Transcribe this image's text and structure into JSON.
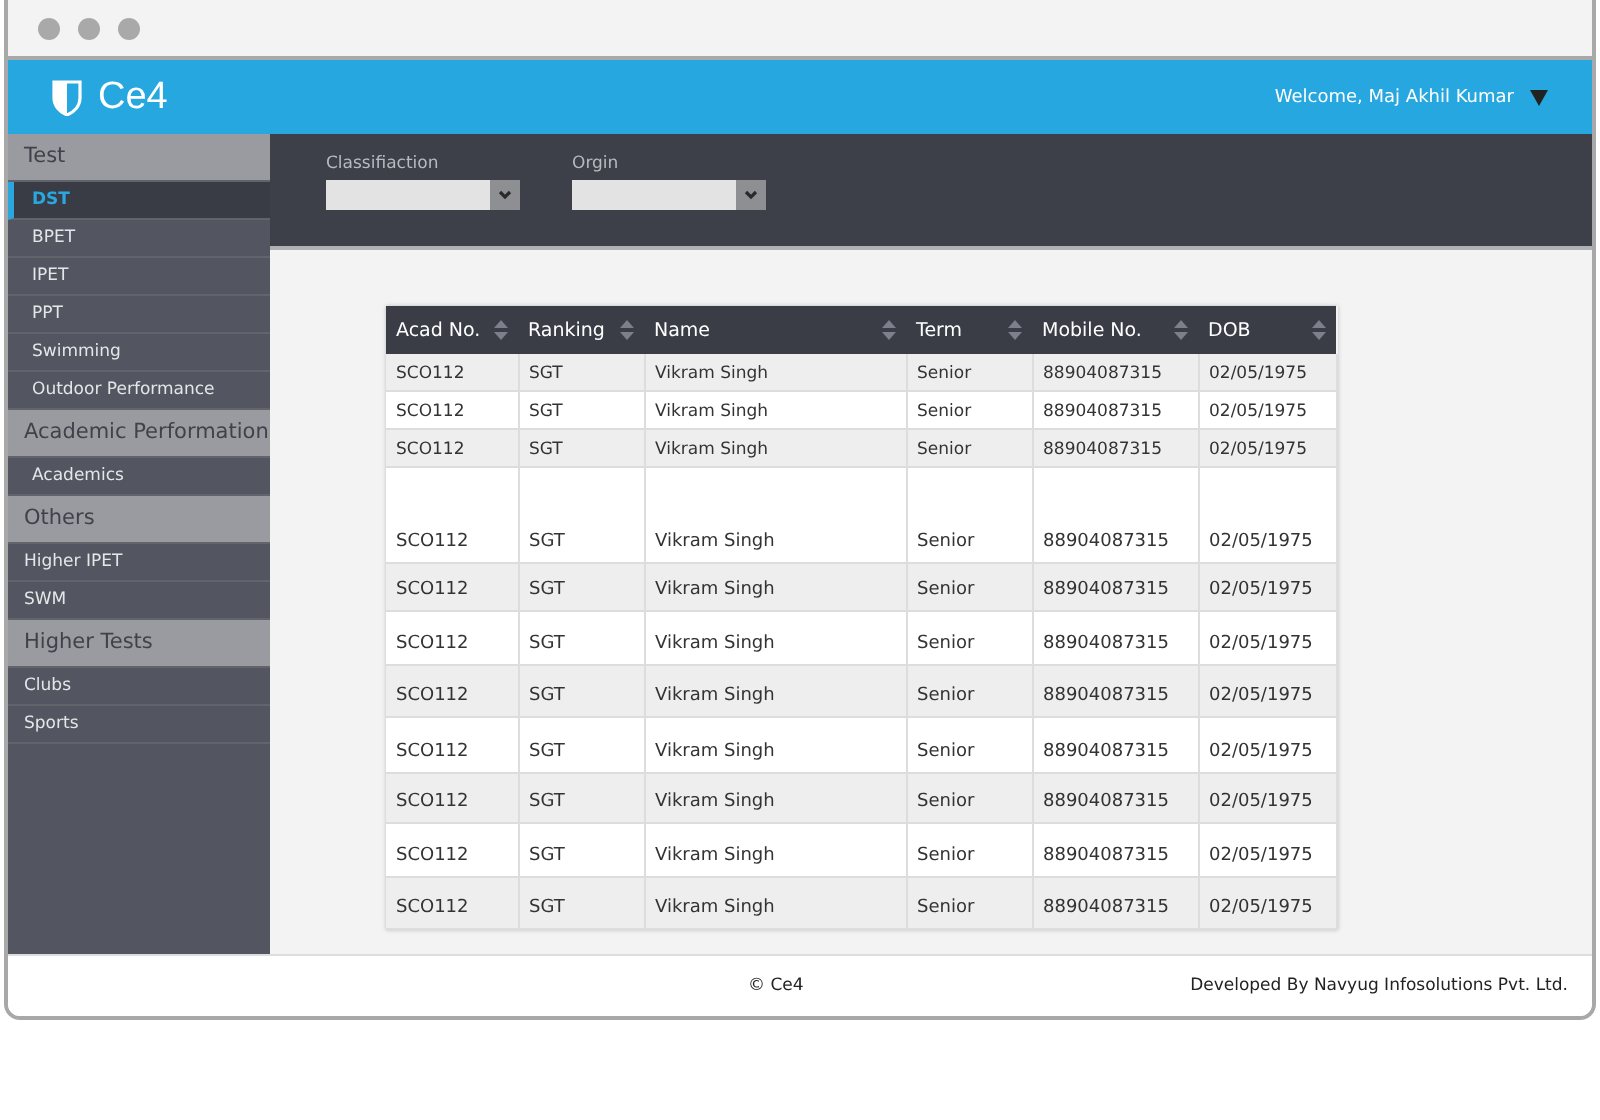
{
  "header": {
    "logo": "Ce4",
    "welcome": "Welcome, Maj Akhil Kumar"
  },
  "sidebar": [
    {
      "title": "Test",
      "items": [
        {
          "label": "DST",
          "selected": true
        },
        {
          "label": "BPET",
          "selected": false
        },
        {
          "label": "IPET",
          "selected": false
        },
        {
          "label": "PPT",
          "selected": false
        },
        {
          "label": "Swimming",
          "selected": false
        },
        {
          "label": "Outdoor Performance",
          "selected": false
        }
      ]
    },
    {
      "title": "Academic Performation",
      "items": [
        {
          "label": "Academics",
          "selected": false
        }
      ]
    },
    {
      "title": "Others",
      "items": [
        {
          "label": "Higher IPET",
          "selected": false
        },
        {
          "label": "SWM",
          "selected": false
        }
      ]
    },
    {
      "title": "Higher Tests",
      "items": [
        {
          "label": "Clubs",
          "selected": false
        },
        {
          "label": "Sports",
          "selected": false
        }
      ]
    }
  ],
  "filters": [
    {
      "label": "Classifiaction"
    },
    {
      "label": "Orgin"
    }
  ],
  "table": {
    "columns": [
      "Acad No.",
      "Ranking",
      "Name",
      "Term",
      "Mobile No.",
      "DOB"
    ],
    "rows": [
      [
        "SCO112",
        "SGT",
        "Vikram Singh",
        "Senior",
        "88904087315",
        "02/05/1975"
      ],
      [
        "SCO112",
        "SGT",
        "Vikram Singh",
        "Senior",
        "88904087315",
        "02/05/1975"
      ],
      [
        "SCO112",
        "SGT",
        "Vikram Singh",
        "Senior",
        "88904087315",
        "02/05/1975"
      ],
      [
        "SCO112",
        "SGT",
        "Vikram Singh",
        "Senior",
        "88904087315",
        "02/05/1975"
      ],
      [
        "SCO112",
        "SGT",
        "Vikram Singh",
        "Senior",
        "88904087315",
        "02/05/1975"
      ],
      [
        "SCO112",
        "SGT",
        "Vikram Singh",
        "Senior",
        "88904087315",
        "02/05/1975"
      ],
      [
        "SCO112",
        "SGT",
        "Vikram Singh",
        "Senior",
        "88904087315",
        "02/05/1975"
      ],
      [
        "SCO112",
        "SGT",
        "Vikram Singh",
        "Senior",
        "88904087315",
        "02/05/1975"
      ],
      [
        "SCO112",
        "SGT",
        "Vikram Singh",
        "Senior",
        "88904087315",
        "02/05/1975"
      ],
      [
        "SCO112",
        "SGT",
        "Vikram Singh",
        "Senior",
        "88904087315",
        "02/05/1975"
      ],
      [
        "SCO112",
        "SGT",
        "Vikram Singh",
        "Senior",
        "88904087315",
        "02/05/1975"
      ]
    ]
  },
  "footer": {
    "copyright": "© Ce4",
    "credit": "Developed By Navyug Infosolutions Pvt. Ltd."
  }
}
